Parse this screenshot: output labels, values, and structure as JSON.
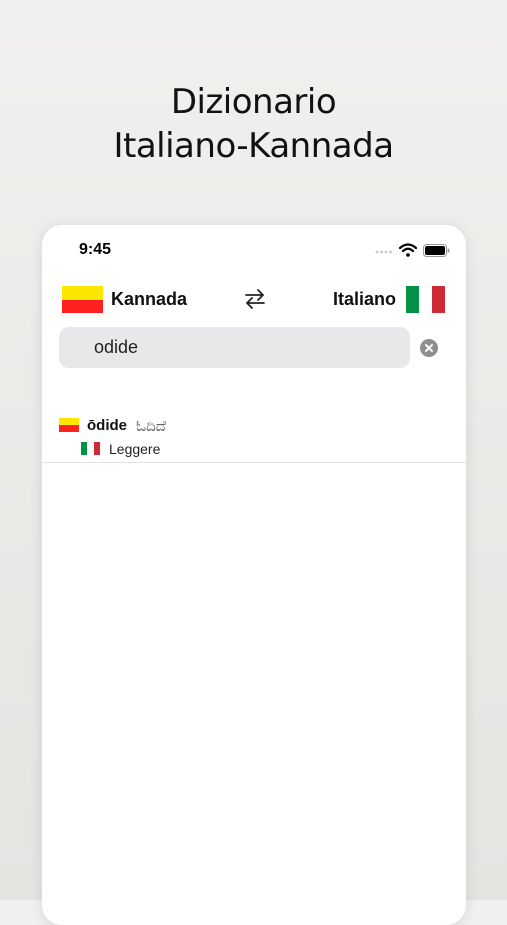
{
  "promo": {
    "title_line1": "Dizionario",
    "title_line2": "Italiano-Kannada"
  },
  "status_bar": {
    "time": "9:45"
  },
  "language_bar": {
    "source_language": "Kannada",
    "target_language": "Italiano",
    "kannada_flag_colors": [
      "#ffe600",
      "#ff2020"
    ],
    "italian_flag_colors": [
      "#009246",
      "#ffffff",
      "#ce2b37"
    ]
  },
  "search": {
    "value": "odide"
  },
  "results": [
    {
      "word": "ōdide",
      "script": "ಓದಿದೆ",
      "translation": "Leggere"
    }
  ]
}
